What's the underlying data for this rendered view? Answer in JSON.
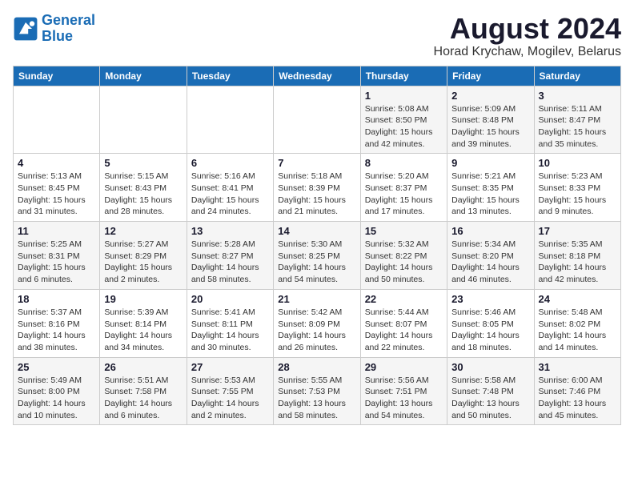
{
  "header": {
    "logo_line1": "General",
    "logo_line2": "Blue",
    "month_year": "August 2024",
    "location": "Horad Krychaw, Mogilev, Belarus"
  },
  "weekdays": [
    "Sunday",
    "Monday",
    "Tuesday",
    "Wednesday",
    "Thursday",
    "Friday",
    "Saturday"
  ],
  "weeks": [
    [
      {
        "day": "",
        "info": ""
      },
      {
        "day": "",
        "info": ""
      },
      {
        "day": "",
        "info": ""
      },
      {
        "day": "",
        "info": ""
      },
      {
        "day": "1",
        "info": "Sunrise: 5:08 AM\nSunset: 8:50 PM\nDaylight: 15 hours\nand 42 minutes."
      },
      {
        "day": "2",
        "info": "Sunrise: 5:09 AM\nSunset: 8:48 PM\nDaylight: 15 hours\nand 39 minutes."
      },
      {
        "day": "3",
        "info": "Sunrise: 5:11 AM\nSunset: 8:47 PM\nDaylight: 15 hours\nand 35 minutes."
      }
    ],
    [
      {
        "day": "4",
        "info": "Sunrise: 5:13 AM\nSunset: 8:45 PM\nDaylight: 15 hours\nand 31 minutes."
      },
      {
        "day": "5",
        "info": "Sunrise: 5:15 AM\nSunset: 8:43 PM\nDaylight: 15 hours\nand 28 minutes."
      },
      {
        "day": "6",
        "info": "Sunrise: 5:16 AM\nSunset: 8:41 PM\nDaylight: 15 hours\nand 24 minutes."
      },
      {
        "day": "7",
        "info": "Sunrise: 5:18 AM\nSunset: 8:39 PM\nDaylight: 15 hours\nand 21 minutes."
      },
      {
        "day": "8",
        "info": "Sunrise: 5:20 AM\nSunset: 8:37 PM\nDaylight: 15 hours\nand 17 minutes."
      },
      {
        "day": "9",
        "info": "Sunrise: 5:21 AM\nSunset: 8:35 PM\nDaylight: 15 hours\nand 13 minutes."
      },
      {
        "day": "10",
        "info": "Sunrise: 5:23 AM\nSunset: 8:33 PM\nDaylight: 15 hours\nand 9 minutes."
      }
    ],
    [
      {
        "day": "11",
        "info": "Sunrise: 5:25 AM\nSunset: 8:31 PM\nDaylight: 15 hours\nand 6 minutes."
      },
      {
        "day": "12",
        "info": "Sunrise: 5:27 AM\nSunset: 8:29 PM\nDaylight: 15 hours\nand 2 minutes."
      },
      {
        "day": "13",
        "info": "Sunrise: 5:28 AM\nSunset: 8:27 PM\nDaylight: 14 hours\nand 58 minutes."
      },
      {
        "day": "14",
        "info": "Sunrise: 5:30 AM\nSunset: 8:25 PM\nDaylight: 14 hours\nand 54 minutes."
      },
      {
        "day": "15",
        "info": "Sunrise: 5:32 AM\nSunset: 8:22 PM\nDaylight: 14 hours\nand 50 minutes."
      },
      {
        "day": "16",
        "info": "Sunrise: 5:34 AM\nSunset: 8:20 PM\nDaylight: 14 hours\nand 46 minutes."
      },
      {
        "day": "17",
        "info": "Sunrise: 5:35 AM\nSunset: 8:18 PM\nDaylight: 14 hours\nand 42 minutes."
      }
    ],
    [
      {
        "day": "18",
        "info": "Sunrise: 5:37 AM\nSunset: 8:16 PM\nDaylight: 14 hours\nand 38 minutes."
      },
      {
        "day": "19",
        "info": "Sunrise: 5:39 AM\nSunset: 8:14 PM\nDaylight: 14 hours\nand 34 minutes."
      },
      {
        "day": "20",
        "info": "Sunrise: 5:41 AM\nSunset: 8:11 PM\nDaylight: 14 hours\nand 30 minutes."
      },
      {
        "day": "21",
        "info": "Sunrise: 5:42 AM\nSunset: 8:09 PM\nDaylight: 14 hours\nand 26 minutes."
      },
      {
        "day": "22",
        "info": "Sunrise: 5:44 AM\nSunset: 8:07 PM\nDaylight: 14 hours\nand 22 minutes."
      },
      {
        "day": "23",
        "info": "Sunrise: 5:46 AM\nSunset: 8:05 PM\nDaylight: 14 hours\nand 18 minutes."
      },
      {
        "day": "24",
        "info": "Sunrise: 5:48 AM\nSunset: 8:02 PM\nDaylight: 14 hours\nand 14 minutes."
      }
    ],
    [
      {
        "day": "25",
        "info": "Sunrise: 5:49 AM\nSunset: 8:00 PM\nDaylight: 14 hours\nand 10 minutes."
      },
      {
        "day": "26",
        "info": "Sunrise: 5:51 AM\nSunset: 7:58 PM\nDaylight: 14 hours\nand 6 minutes."
      },
      {
        "day": "27",
        "info": "Sunrise: 5:53 AM\nSunset: 7:55 PM\nDaylight: 14 hours\nand 2 minutes."
      },
      {
        "day": "28",
        "info": "Sunrise: 5:55 AM\nSunset: 7:53 PM\nDaylight: 13 hours\nand 58 minutes."
      },
      {
        "day": "29",
        "info": "Sunrise: 5:56 AM\nSunset: 7:51 PM\nDaylight: 13 hours\nand 54 minutes."
      },
      {
        "day": "30",
        "info": "Sunrise: 5:58 AM\nSunset: 7:48 PM\nDaylight: 13 hours\nand 50 minutes."
      },
      {
        "day": "31",
        "info": "Sunrise: 6:00 AM\nSunset: 7:46 PM\nDaylight: 13 hours\nand 45 minutes."
      }
    ]
  ]
}
